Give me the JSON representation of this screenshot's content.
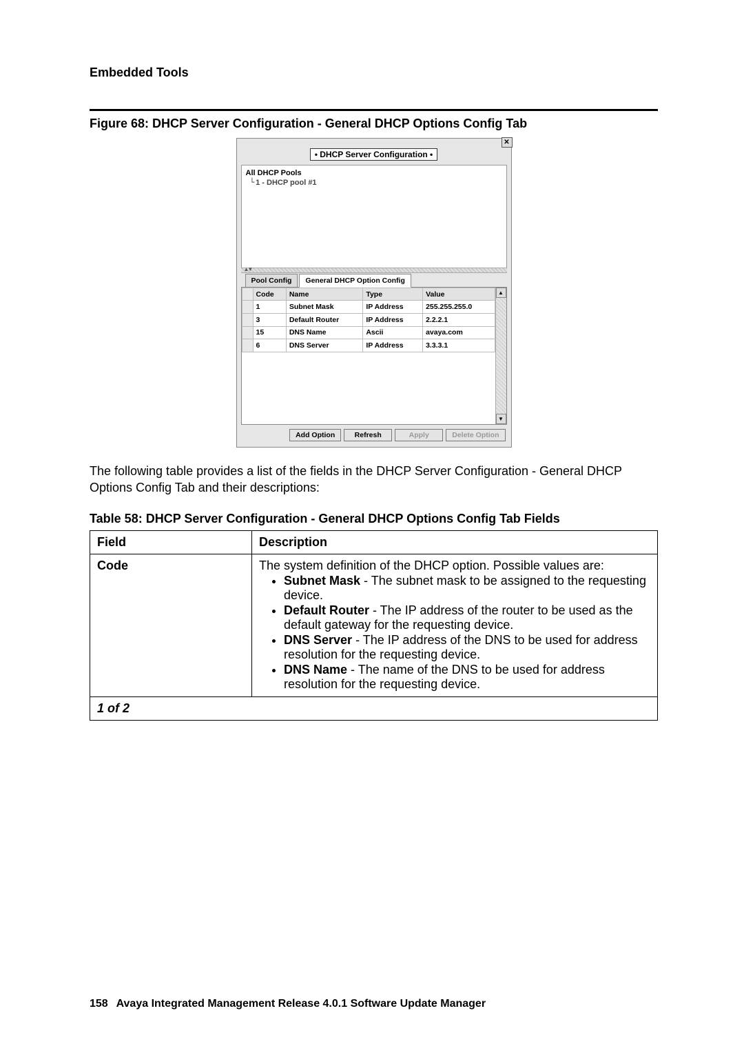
{
  "header": {
    "section": "Embedded Tools"
  },
  "figure": {
    "caption": "Figure 68: DHCP Server Configuration - General DHCP Options Config Tab"
  },
  "dialog": {
    "title": "• DHCP Server Configuration •",
    "close_glyph": "✕",
    "tree": {
      "root": "All DHCP Pools",
      "child": "1 - DHCP pool #1"
    },
    "tabs": {
      "pool": "Pool Config",
      "general": "General DHCP Option Config"
    },
    "columns": {
      "code": "Code",
      "name": "Name",
      "type": "Type",
      "value": "Value"
    },
    "rows": [
      {
        "code": "1",
        "name": "Subnet Mask",
        "type": "IP Address",
        "value": "255.255.255.0"
      },
      {
        "code": "3",
        "name": "Default Router",
        "type": "IP Address",
        "value": "2.2.2.1"
      },
      {
        "code": "15",
        "name": "DNS Name",
        "type": "Ascii",
        "value": "avaya.com"
      },
      {
        "code": "6",
        "name": "DNS Server",
        "type": "IP Address",
        "value": "3.3.3.1"
      }
    ],
    "buttons": {
      "add": "Add Option",
      "refresh": "Refresh",
      "apply": "Apply",
      "delete": "Delete Option"
    },
    "scroll": {
      "up": "▲",
      "down": "▼"
    }
  },
  "intro_text": "The following table provides a list of the fields in the DHCP Server Configuration - General DHCP Options Config Tab and their descriptions:",
  "table": {
    "caption": "Table 58: DHCP Server Configuration - General DHCP Options Config Tab Fields",
    "head": {
      "field": "Field",
      "desc": "Description"
    },
    "row1": {
      "field": "Code",
      "lead": "The system definition of the DHCP option. Possible values are:",
      "items": [
        {
          "b": "Subnet Mask",
          "t": " - The subnet mask to be assigned to the requesting device."
        },
        {
          "b": "Default Router",
          "t": " - The IP address of the router to be used as the default gateway for the requesting device."
        },
        {
          "b": "DNS Server",
          "t": " - The IP address of the DNS to be used for address resolution for the requesting device."
        },
        {
          "b": "DNS Name",
          "t": " - The name of the DNS to be used for address resolution for the requesting device."
        }
      ]
    },
    "pager": "1 of 2"
  },
  "footer": {
    "page": "158",
    "title": "Avaya Integrated Management Release 4.0.1 Software Update Manager"
  }
}
